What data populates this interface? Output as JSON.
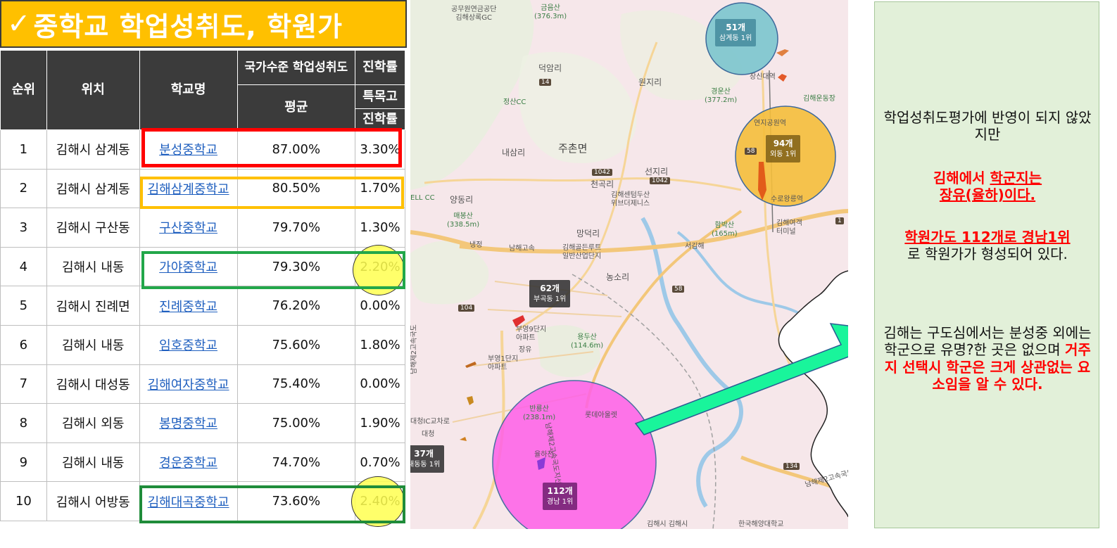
{
  "title": {
    "check_glyph": "✓",
    "text": "중학교 학업성취도, 학원가"
  },
  "table": {
    "headers": {
      "rank": "순위",
      "location": "위치",
      "school": "학교명",
      "achievement": "국가수준 학업성취도",
      "average": "평균",
      "rate": "진학률",
      "special": "특목고",
      "rate2": "진학률"
    },
    "rows": [
      {
        "rank": "1",
        "location": "김해시 삼계동",
        "school": "분성중학교",
        "avg": "87.00%",
        "rate": "3.30%"
      },
      {
        "rank": "2",
        "location": "김해시 삼계동",
        "school": "김해삼계중학교",
        "avg": "80.50%",
        "rate": "1.70%"
      },
      {
        "rank": "3",
        "location": "김해시 구산동",
        "school": "구산중학교",
        "avg": "79.70%",
        "rate": "1.30%"
      },
      {
        "rank": "4",
        "location": "김해시 내동",
        "school": "가야중학교",
        "avg": "79.30%",
        "rate": "2.20%"
      },
      {
        "rank": "5",
        "location": "김해시 진례면",
        "school": "진례중학교",
        "avg": "76.20%",
        "rate": "0.00%"
      },
      {
        "rank": "6",
        "location": "김해시 내동",
        "school": "임호중학교",
        "avg": "75.60%",
        "rate": "1.80%"
      },
      {
        "rank": "7",
        "location": "김해시 대성동",
        "school": "김해여자중학교",
        "avg": "75.40%",
        "rate": "0.00%"
      },
      {
        "rank": "8",
        "location": "김해시 외동",
        "school": "봉명중학교",
        "avg": "75.00%",
        "rate": "1.90%"
      },
      {
        "rank": "9",
        "location": "김해시 내동",
        "school": "경운중학교",
        "avg": "74.70%",
        "rate": "0.70%"
      },
      {
        "rank": "10",
        "location": "김해시 어방동",
        "school": "김해대곡중학교",
        "avg": "73.60%",
        "rate": "2.40%"
      }
    ]
  },
  "map": {
    "places": {
      "p1": "공무원연금공단\n김해상록GC",
      "p2": "금음산\n(376.3m)",
      "p3": "덕암리",
      "p4": "원지리",
      "p5": "정산CC",
      "p6": "경운산\n(377.2m)",
      "p7": "김해운동장",
      "p8": "장신대역",
      "p9": "내삼리",
      "p10": "주촌면",
      "p11": "선지리",
      "p12": "천곡리",
      "p13": "김해센텀두산\n위브더제니스",
      "p14": "양동리",
      "p15": "매봉산\n(338.5m)",
      "p16": "ELL CC",
      "p17": "연지공원역",
      "p18": "수로왕릉역",
      "p19": "함박산\n(165m)",
      "p20": "김해여객\n터미널",
      "p21": "망덕리",
      "p22": "냉정",
      "p23": "남해고속",
      "p24": "김해골든루트\n일반산업단지",
      "p25": "서김해",
      "p26": "농소리",
      "p27": "부영9단지\n아파트",
      "p28": "장유",
      "p29": "부영1단지\n아파트",
      "p30": "용두산\n(114.6m)",
      "p31": "반룡산\n(238.1m)",
      "p32": "롯데아울렛",
      "p33": "대청IC교차로",
      "p34": "대청",
      "p35": "율하천",
      "p36": "한국해양대학교",
      "p37": "남해제2고속국도",
      "p38": "남해제2고속국도지선",
      "p39": "김해시 김해시"
    },
    "roads": [
      "14",
      "1042",
      "1042",
      "104",
      "58",
      "58",
      "1",
      "134"
    ],
    "badges": [
      {
        "count": "51개",
        "sub": "삼계동 1위"
      },
      {
        "count": "94개",
        "sub": "외동 1위"
      },
      {
        "count": "62개",
        "sub": "부곡동 1위"
      },
      {
        "count": "37개",
        "sub": "내동동 1위"
      },
      {
        "count": "112개",
        "sub": "경남 1위"
      }
    ],
    "colors": {
      "teal_circle": "#7cc6cf",
      "gold_circle": "#f5be3c",
      "pink_circle": "#ff5fe8",
      "arrow": "#19f59b"
    }
  },
  "panel": {
    "para1": "학업성취도평가에 반영이 되지 않았지만",
    "para2_a": "김해에서 ",
    "para2_b": "학군지는",
    "para2_c": "장유(율하)이다.",
    "para3_a": "학원가도 112개로 경남1위",
    "para3_b": "로 학원가가 형성되어 있다.",
    "para4_a": "김해는 구도심에서는 분성중 외에는 학군으로 유명?한 곳은 없으며 ",
    "para4_b": "거주지 선택시 학군은 크게 상관없는 요소임을 알 수 있다."
  },
  "colors": {
    "title_bg": "#ffc000",
    "header_bg": "#3b3b3b",
    "link": "#1f5fbf",
    "highlight_red": "#ff0000",
    "highlight_orange": "#ffc000",
    "highlight_green": "#22a74a",
    "panel_bg": "#e2f0d9"
  }
}
